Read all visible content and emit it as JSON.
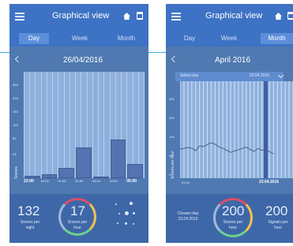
{
  "screen_left": {
    "header": {
      "title": "Graphical view",
      "menu_icon": "menu-icon",
      "home_icon": "home-icon",
      "calendar_icon": "calendar-icon"
    },
    "tabs": [
      {
        "label": "Day",
        "active": true
      },
      {
        "label": "Week",
        "active": false
      },
      {
        "label": "Month",
        "active": false
      }
    ],
    "date": "26/04/2016",
    "chart_data": {
      "type": "bar",
      "categories": [
        "23:00",
        "00:00",
        "01:00",
        "02:00",
        "03:00",
        "04:00",
        "05:00"
      ],
      "values": [
        6,
        12,
        28,
        86,
        4,
        108,
        40
      ],
      "ylim": [
        0,
        300
      ],
      "yticks": [
        "300",
        "200",
        "150",
        "100",
        "50",
        "25"
      ],
      "ylabel": "Snores",
      "xtick_labels": [
        "23:00",
        "00:00",
        "01:00",
        "02:00",
        "03:00",
        "04:00",
        "05:00"
      ]
    },
    "footer": {
      "snores_per_night_value": "132",
      "snores_per_night_label": "Snores per night",
      "snores_per_hour_value": "17",
      "snores_per_hour_label": "Snores per hour"
    }
  },
  "screen_right": {
    "header": {
      "title": "Graphical view",
      "menu_icon": "menu-icon",
      "home_icon": "home-icon",
      "calendar_icon": "calendar-icon"
    },
    "tabs": [
      {
        "label": "Day",
        "active": false
      },
      {
        "label": "Week",
        "active": false
      },
      {
        "label": "Month",
        "active": true
      }
    ],
    "month": "April 2016",
    "select_day_label": "Select day",
    "select_day_value": "23.04.2016",
    "chart_data": {
      "type": "line",
      "x_start_label": "01.04",
      "x_end_label": "23.04.2016",
      "ylabel": "Snores per hour",
      "yticks": [
        "300",
        "200",
        "100",
        "50",
        "0"
      ],
      "ylim": [
        0,
        300
      ],
      "selected_day": 23,
      "x": [
        1,
        2,
        3,
        4,
        5,
        6,
        7,
        8,
        9,
        10,
        11,
        12,
        13,
        14,
        15,
        16,
        17,
        18,
        19,
        20,
        21,
        22,
        23,
        24,
        25
      ],
      "values": [
        90,
        92,
        95,
        93,
        85,
        100,
        98,
        104,
        110,
        105,
        97,
        92,
        86,
        80,
        84,
        88,
        92,
        96,
        89,
        83,
        92,
        86,
        88,
        82,
        75
      ]
    },
    "footer": {
      "chosen_day_label": "Chosen day",
      "chosen_day_value": "23.04.2016",
      "snores_per_hour_value": "200",
      "snores_per_hour_label": "Snores per hour",
      "signals_per_hour_value": "200",
      "signals_per_hour_label": "Signals per hour"
    }
  },
  "colors": {
    "brand_blue": "#3d72c4",
    "chart_bg": "#8fb0dd",
    "connector": "#29b4e3"
  }
}
